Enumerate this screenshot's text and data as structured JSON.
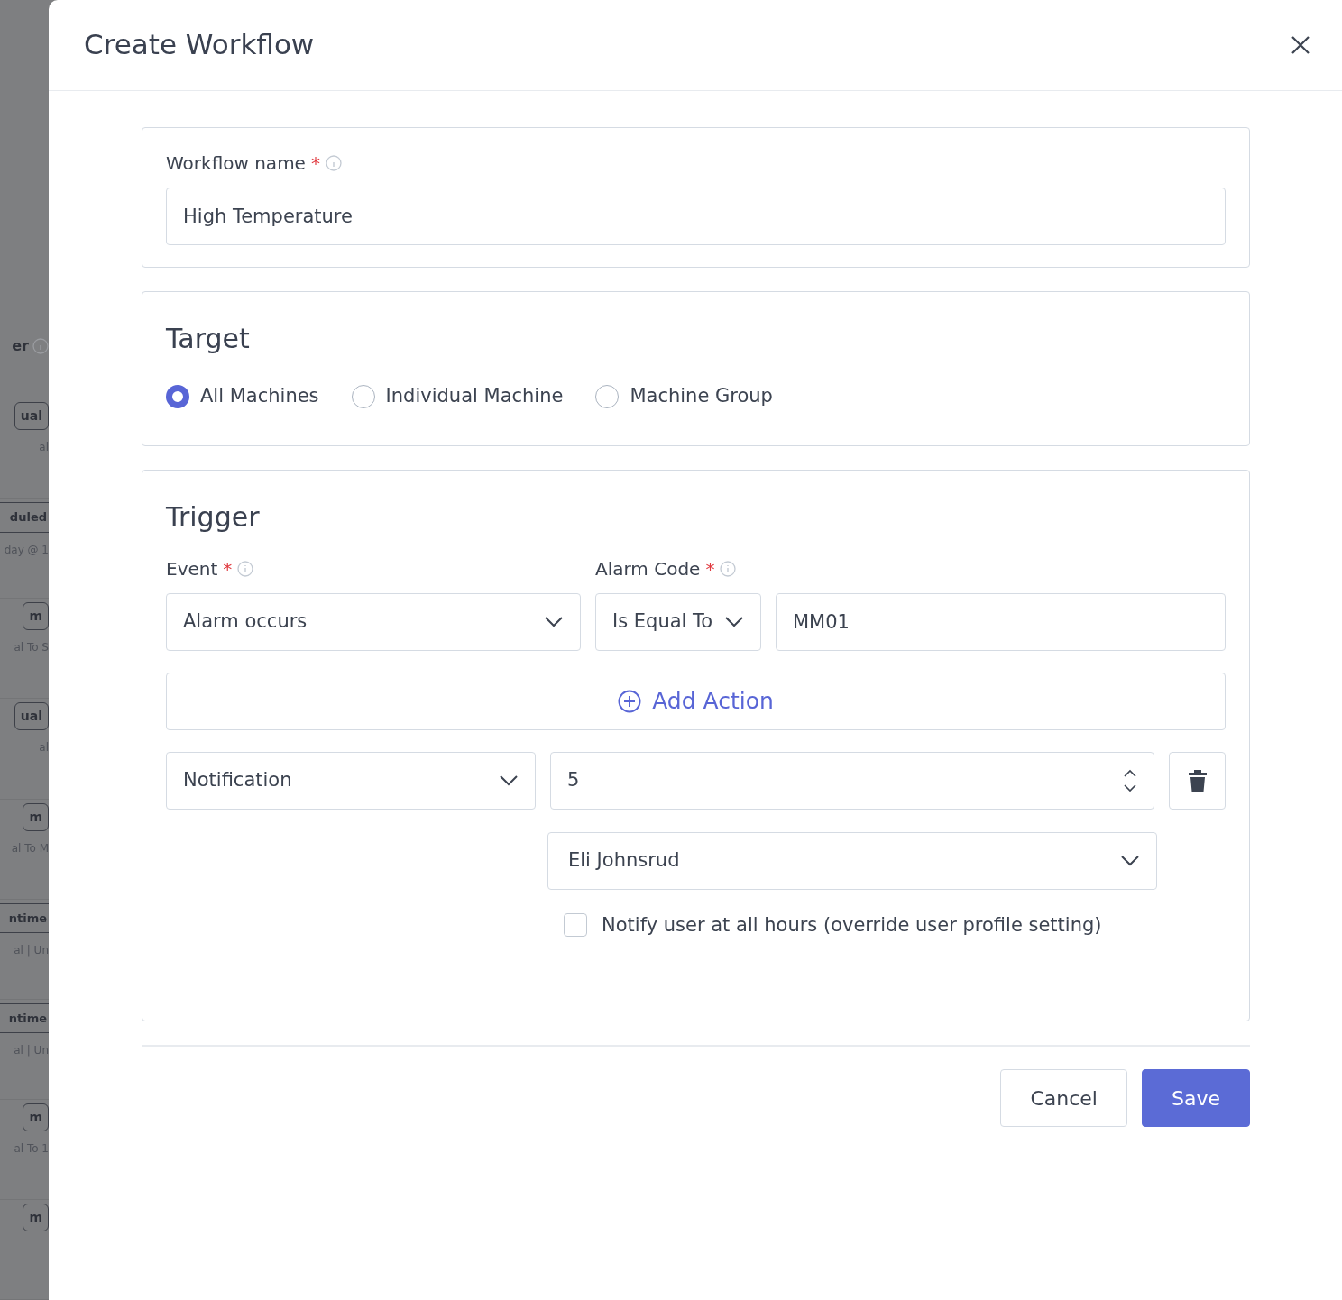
{
  "background_rows": [
    {
      "kind": "label",
      "text": "er"
    },
    {
      "kind": "badge",
      "text": "ual",
      "sub": "al"
    },
    {
      "kind": "band",
      "text": "duled",
      "sub": "day @ 1"
    },
    {
      "kind": "badge",
      "text": "m",
      "sub": "al To S"
    },
    {
      "kind": "badge",
      "text": "ual",
      "sub": "al"
    },
    {
      "kind": "badge",
      "text": "m",
      "sub": "al To M"
    },
    {
      "kind": "band",
      "text": "ntime",
      "sub": "al | Un"
    },
    {
      "kind": "band",
      "text": "ntime",
      "sub": "al | Un"
    },
    {
      "kind": "badge",
      "text": "m",
      "sub": "al To 1"
    },
    {
      "kind": "badge",
      "text": "m"
    }
  ],
  "dialog": {
    "title": "Create Workflow"
  },
  "workflow_name": {
    "label": "Workflow name",
    "required_mark": "*",
    "value": "High Temperature"
  },
  "target": {
    "title": "Target",
    "options": [
      {
        "label": "All Machines",
        "selected": true
      },
      {
        "label": "Individual Machine",
        "selected": false
      },
      {
        "label": "Machine Group",
        "selected": false
      }
    ]
  },
  "trigger": {
    "title": "Trigger",
    "event": {
      "label": "Event",
      "required_mark": "*",
      "value": "Alarm occurs"
    },
    "alarm_code": {
      "label": "Alarm Code",
      "required_mark": "*",
      "operator": "Is Equal To",
      "value": "MM01"
    },
    "add_action": "Add Action",
    "actions": [
      {
        "type": "Notification",
        "value": "5",
        "recipient": "Eli Johnsrud",
        "notify_all_hours": {
          "label": "Notify user at all hours (override user profile setting)",
          "checked": false
        }
      }
    ]
  },
  "buttons": {
    "cancel": "Cancel",
    "save": "Save"
  }
}
